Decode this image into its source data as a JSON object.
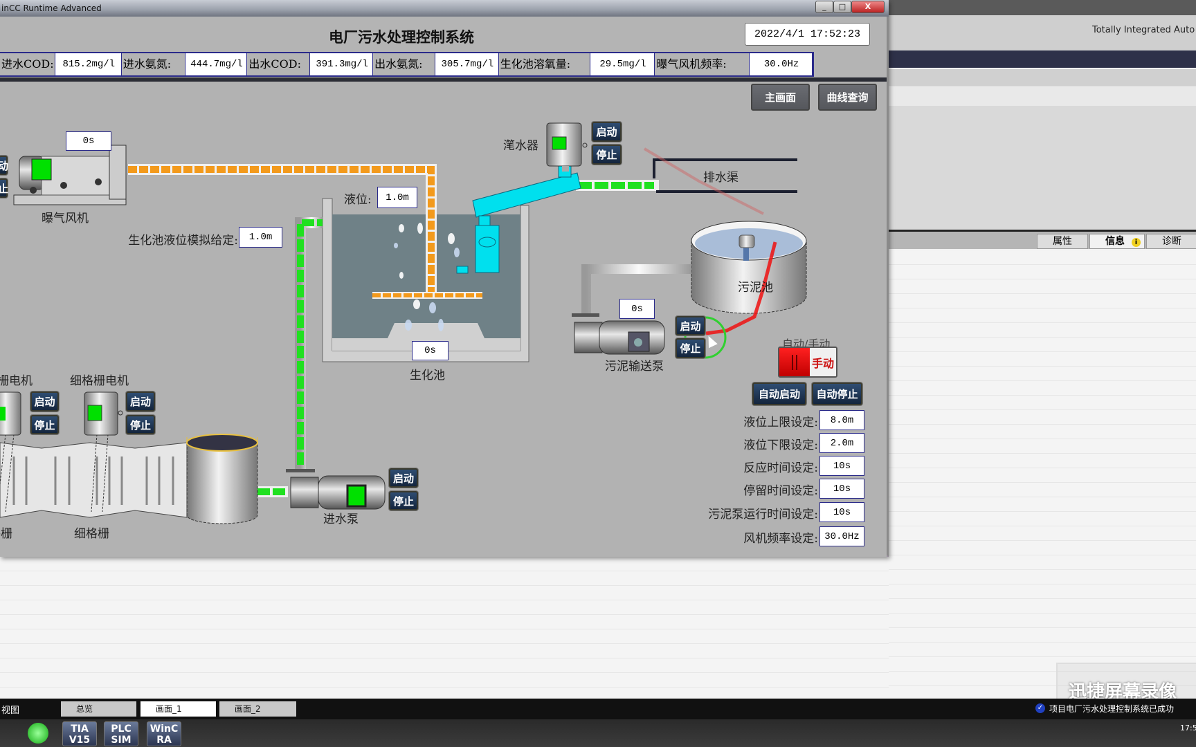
{
  "window": {
    "title": "inCC Runtime Advanced",
    "controls": [
      "_",
      "□",
      "X"
    ]
  },
  "header": {
    "title": "电厂污水处理控制系统",
    "datetime": "2022/4/1 17:52:23"
  },
  "metrics": [
    {
      "label": "进水COD:",
      "value": "815.2mg/l"
    },
    {
      "label": "进水氨氮:",
      "value": "444.7mg/l"
    },
    {
      "label": "出水COD:",
      "value": "391.3mg/l"
    },
    {
      "label": "出水氨氮:",
      "value": "305.7mg/l"
    },
    {
      "label": "生化池溶氧量:",
      "value": "29.5mg/l"
    },
    {
      "label": "曝气风机频率:",
      "value": "30.0Hz"
    }
  ],
  "nav": {
    "main": "主画面",
    "trend": "曲线查询"
  },
  "buttons": {
    "start": "启动",
    "stop": "停止",
    "start_partial": "动",
    "stop_partial": "止"
  },
  "equipment": {
    "blower": {
      "label": "曝气风机",
      "timer": "0s"
    },
    "decanter": {
      "label": "滗水器"
    },
    "drain": {
      "label": "排水渠"
    },
    "level": {
      "label": "液位:",
      "value": "1.0m"
    },
    "level_sim": {
      "label": "生化池液位模拟给定:",
      "value": "1.0m"
    },
    "biotank": {
      "label": "生化池",
      "timer": "0s"
    },
    "sludge_tank": {
      "label": "污泥池"
    },
    "sludge_pump": {
      "label": "污泥输送泵",
      "timer": "0s"
    },
    "coarse_motor": {
      "label": "栅电机"
    },
    "fine_motor": {
      "label": "细格栅电机"
    },
    "coarse_screen": {
      "label": "格栅"
    },
    "fine_screen": {
      "label": "细格栅"
    },
    "inlet_pump": {
      "label": "进水泵"
    }
  },
  "mode": {
    "label": "自动/手动",
    "state": "手动",
    "auto_start": "自动启动",
    "auto_stop": "自动停止"
  },
  "settings": [
    {
      "label": "液位上限设定:",
      "value": "8.0m"
    },
    {
      "label": "液位下限设定:",
      "value": "2.0m"
    },
    {
      "label": "反应时间设定:",
      "value": "10s"
    },
    {
      "label": "停留时间设定:",
      "value": "10s"
    },
    {
      "label": "污泥泵运行时间设定:",
      "value": "10s"
    },
    {
      "label": "风机频率设定:",
      "value": "30.0Hz"
    }
  ],
  "tia": {
    "brand": "Totally Integrated Auto",
    "tabs": [
      "属性",
      "信息",
      "诊断"
    ]
  },
  "bottom_tabs": {
    "view": "视图",
    "items": [
      "总览",
      "画面_1",
      "画面_2"
    ],
    "status": "项目电厂污水处理控制系统已成功"
  },
  "taskbar": {
    "apps": [
      {
        "l1": "TIA",
        "l2": "V15"
      },
      {
        "l1": "PLC",
        "l2": "SIM"
      },
      {
        "l1": "WinC",
        "l2": "RA"
      }
    ],
    "clock": "17:5"
  },
  "watermark": "迅捷屏幕录像",
  "colors": {
    "running": "#00e000",
    "pipe_air": "#f39a1c",
    "pipe_water": "#20e020",
    "manual": "#cc1111"
  }
}
